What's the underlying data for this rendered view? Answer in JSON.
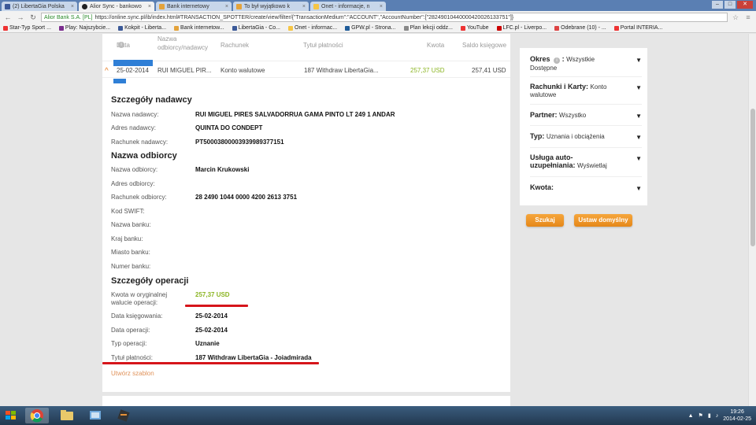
{
  "browser": {
    "tabs": [
      {
        "label": "(2) LibertaGia Polska",
        "color": "#3b5998",
        "active": false
      },
      {
        "label": "Alior Sync - bankowo",
        "color": "#222",
        "active": true
      },
      {
        "label": "Bank internetowy",
        "color": "#e4a33b",
        "active": false
      },
      {
        "label": "To był wyjątkowo k",
        "color": "#e4a33b",
        "active": false
      },
      {
        "label": "Onet - informacje, n",
        "color": "#f6c544",
        "active": false
      }
    ],
    "secure_label": "Alior Bank S.A. [PL]",
    "url": "https://online.sync.pl/ib/index.html#TRANSACTION_SPOTTER/create/view/filter/{\"TransactionMedium\":\"ACCOUNT\",\"AccountNumber\":[\"28249010440000420026133751\"]}",
    "bookmarks": [
      {
        "label": "Star-Typ Sport ...",
        "color": "#e33"
      },
      {
        "label": "Play: Najszybcie...",
        "color": "#7b2d8e"
      },
      {
        "label": "Kokpit - Liberta...",
        "color": "#3b5998"
      },
      {
        "label": "Bank internetow...",
        "color": "#e4a33b"
      },
      {
        "label": "LibertaGia - Co...",
        "color": "#3b5998"
      },
      {
        "label": "Onet - informac...",
        "color": "#f6c544"
      },
      {
        "label": "GPW.pl - Strona...",
        "color": "#1f5c99"
      },
      {
        "label": "Plan lekcji oddz...",
        "color": "#888"
      },
      {
        "label": "YouTube",
        "color": "#e33"
      },
      {
        "label": "LFC.pl - Liverpo...",
        "color": "#c00"
      },
      {
        "label": "Odebrane (10) - ...",
        "color": "#d44"
      },
      {
        "label": "Portal INTERIA...",
        "color": "#e33"
      }
    ]
  },
  "table": {
    "headers": {
      "date": "Data",
      "recipient": "Nazwa odbiorcy/nadawcy",
      "account": "Rachunek",
      "title": "Tytuł płatności",
      "amount": "Kwota",
      "balance": "Saldo księgowe"
    },
    "row": {
      "date": "25-02-2014",
      "name": "RUI MIGUEL PIR...",
      "account": "Konto walutowe",
      "title": "187 Withdraw LibertaGia...",
      "amount": "257,37 USD",
      "balance": "257,41 USD"
    }
  },
  "details": {
    "sender_title": "Szczegóły nadawcy",
    "sender": [
      {
        "label": "Nazwa nadawcy:",
        "value": "RUI MIGUEL PIRES SALVADORRUA GAMA PINTO LT 249 1 ANDAR"
      },
      {
        "label": "Adres nadawcy:",
        "value": "QUINTA DO CONDEPT"
      },
      {
        "label": "Rachunek nadawcy:",
        "value": "PT50003800003939989377151"
      }
    ],
    "recipient_title": "Nazwa odbiorcy",
    "recipient": [
      {
        "label": "Nazwa odbiorcy:",
        "value": "Marcin Krukowski"
      },
      {
        "label": "Adres odbiorcy:",
        "value": ""
      },
      {
        "label": "Rachunek odbiorcy:",
        "value": "28 2490 1044 0000 4200 2613 3751"
      },
      {
        "label": "Kod SWIFT:",
        "value": ""
      },
      {
        "label": "Nazwa banku:",
        "value": ""
      },
      {
        "label": "Kraj banku:",
        "value": ""
      },
      {
        "label": "Miasto banku:",
        "value": ""
      },
      {
        "label": "Numer banku:",
        "value": ""
      }
    ],
    "operation_title": "Szczegóły operacji",
    "original_amount_label_1": "Kwota w oryginalnej",
    "original_amount_label_2": "walucie operacji:",
    "original_amount": "257,37 USD",
    "operation": [
      {
        "label": "Data księgowania:",
        "value": "25-02-2014"
      },
      {
        "label": "Data operacji:",
        "value": "25-02-2014"
      },
      {
        "label": "Typ operacji:",
        "value": "Uznanie"
      },
      {
        "label": "Tytuł płatności:",
        "value": "187 Withdraw LibertaGia - Joiadmirada"
      }
    ],
    "create_template": "Utwórz szablon"
  },
  "filters": {
    "period_label": "Okres",
    "period_value_1": "Wszystkie",
    "period_value_2": "Dostępne",
    "accounts_label": "Rachunki i Karty:",
    "accounts_value_1": "Konto",
    "accounts_value_2": "walutowe",
    "partner_label": "Partner:",
    "partner_value": "Wszystko",
    "type_label": "Typ:",
    "type_value": "Uznania i obciążenia",
    "autofill_label_1": "Usługa auto-",
    "autofill_label_2": "uzupełniania:",
    "autofill_value": "Wyświetlaj",
    "amount_label": "Kwota:",
    "search_button": "Szukaj",
    "default_button": "Ustaw domyślny"
  },
  "taskbar": {
    "time": "19:26",
    "date": "2014-02-25"
  },
  "colors": {
    "accent_orange": "#e58719",
    "amount_green": "#8bb523",
    "highlight_red": "#d6151b",
    "mark_blue": "#2f7fd6"
  }
}
